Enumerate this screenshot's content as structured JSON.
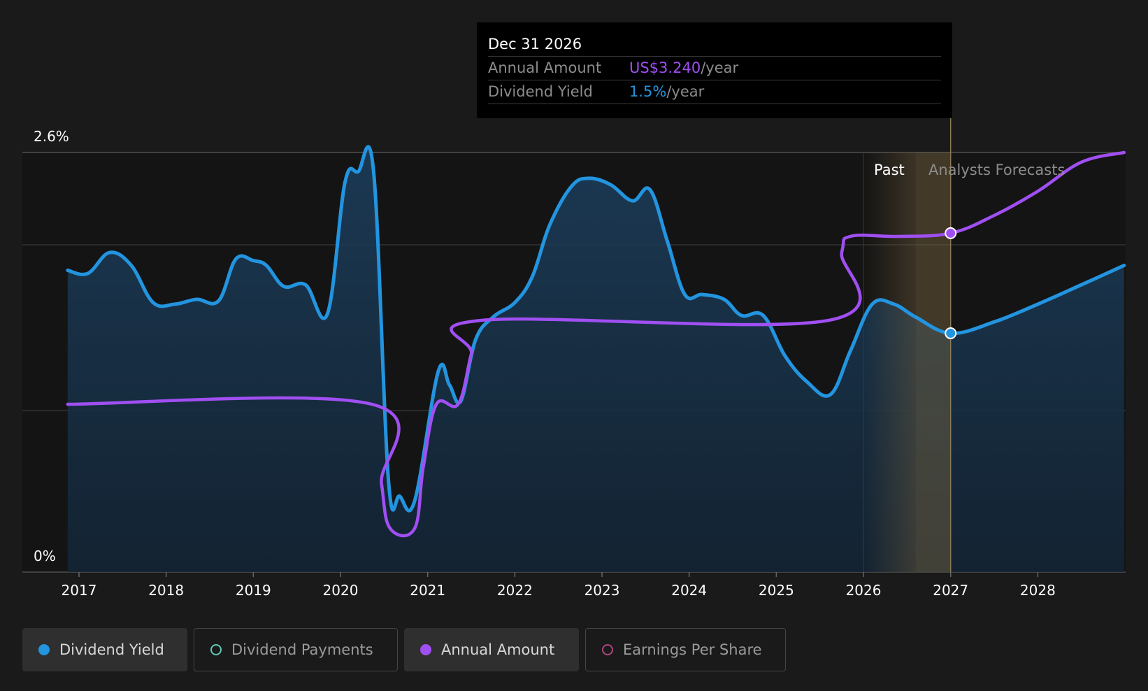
{
  "chart_data": {
    "type": "line",
    "y_axis": {
      "top_label": "2.6%",
      "bottom_label": "0%",
      "ylim": [
        0,
        2.6
      ]
    },
    "x_axis": {
      "ticks": [
        "2017",
        "2018",
        "2019",
        "2020",
        "2021",
        "2022",
        "2023",
        "2024",
        "2025",
        "2026",
        "2027",
        "2028"
      ]
    },
    "regions": {
      "past_label": "Past",
      "forecast_label": "Analysts Forecasts"
    },
    "series": [
      {
        "name": "Dividend Yield",
        "color": "#2394df",
        "points": [
          [
            2016.87,
            1.87
          ],
          [
            2017.1,
            1.85
          ],
          [
            2017.35,
            1.98
          ],
          [
            2017.6,
            1.9
          ],
          [
            2017.85,
            1.67
          ],
          [
            2018.1,
            1.66
          ],
          [
            2018.35,
            1.69
          ],
          [
            2018.6,
            1.68
          ],
          [
            2018.8,
            1.94
          ],
          [
            2019.0,
            1.93
          ],
          [
            2019.15,
            1.9
          ],
          [
            2019.35,
            1.77
          ],
          [
            2019.6,
            1.78
          ],
          [
            2019.85,
            1.6
          ],
          [
            2020.05,
            2.41
          ],
          [
            2020.2,
            2.48
          ],
          [
            2020.38,
            2.48
          ],
          [
            2020.55,
            0.57
          ],
          [
            2020.68,
            0.47
          ],
          [
            2020.85,
            0.44
          ],
          [
            2021.12,
            1.24
          ],
          [
            2021.25,
            1.16
          ],
          [
            2021.38,
            1.06
          ],
          [
            2021.55,
            1.44
          ],
          [
            2021.75,
            1.58
          ],
          [
            2022.0,
            1.67
          ],
          [
            2022.2,
            1.83
          ],
          [
            2022.4,
            2.15
          ],
          [
            2022.65,
            2.39
          ],
          [
            2022.85,
            2.44
          ],
          [
            2023.1,
            2.4
          ],
          [
            2023.35,
            2.3
          ],
          [
            2023.55,
            2.37
          ],
          [
            2023.75,
            2.05
          ],
          [
            2023.95,
            1.72
          ],
          [
            2024.15,
            1.72
          ],
          [
            2024.4,
            1.69
          ],
          [
            2024.6,
            1.59
          ],
          [
            2024.85,
            1.59
          ],
          [
            2025.1,
            1.34
          ],
          [
            2025.35,
            1.18
          ],
          [
            2025.62,
            1.1
          ],
          [
            2025.85,
            1.37
          ],
          [
            2026.1,
            1.66
          ],
          [
            2026.35,
            1.66
          ],
          [
            2026.6,
            1.58
          ],
          [
            2027.0,
            1.48
          ],
          [
            2027.5,
            1.55
          ],
          [
            2028.0,
            1.66
          ],
          [
            2028.5,
            1.78
          ],
          [
            2028.99,
            1.9
          ]
        ]
      },
      {
        "name": "Annual Amount",
        "color": "#a04ff2",
        "points": [
          [
            2016.87,
            1.04
          ],
          [
            2020.36,
            1.04
          ],
          [
            2020.47,
            0.55
          ],
          [
            2020.57,
            0.27
          ],
          [
            2020.85,
            0.27
          ],
          [
            2020.95,
            0.65
          ],
          [
            2021.1,
            1.04
          ],
          [
            2021.35,
            1.04
          ],
          [
            2021.5,
            1.35
          ],
          [
            2021.62,
            1.56
          ],
          [
            2025.6,
            1.56
          ],
          [
            2025.75,
            1.98
          ],
          [
            2025.85,
            2.08
          ],
          [
            2026.4,
            2.08
          ],
          [
            2027.0,
            2.1
          ],
          [
            2027.5,
            2.21
          ],
          [
            2028.0,
            2.36
          ],
          [
            2028.5,
            2.54
          ],
          [
            2028.99,
            2.76
          ]
        ]
      }
    ],
    "highlight": {
      "x": 2027.0,
      "dividend_yield": 1.48,
      "annual_amount": 2.1
    }
  },
  "tooltip": {
    "date": "Dec 31 2026",
    "annual_label": "Annual Amount",
    "annual_value": "US$3.240",
    "annual_unit": "/year",
    "yield_label": "Dividend Yield",
    "yield_value": "1.5%",
    "yield_unit": "/year",
    "annual_color": "#a04ff2",
    "yield_color": "#2394df"
  },
  "legend": [
    {
      "label": "Dividend Yield",
      "color": "#2394df",
      "filled": true,
      "active": true
    },
    {
      "label": "Dividend Payments",
      "color": "#5fc9b7",
      "filled": false,
      "active": false
    },
    {
      "label": "Annual Amount",
      "color": "#a04ff2",
      "filled": true,
      "active": true
    },
    {
      "label": "Earnings Per Share",
      "color": "#b0457e",
      "filled": false,
      "active": false
    }
  ]
}
